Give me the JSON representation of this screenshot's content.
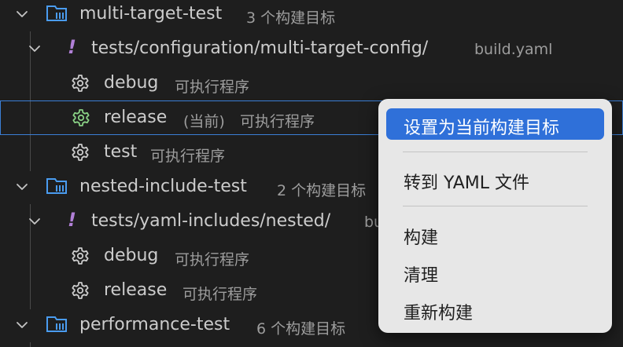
{
  "tree": {
    "project1": {
      "name": "multi-target-test",
      "desc": "3 个构建目标"
    },
    "config1": {
      "path": "tests/configuration/multi-target-config/",
      "file": "build.yaml"
    },
    "target_debug1": {
      "name": "debug",
      "desc": "可执行程序"
    },
    "target_release1": {
      "name": "release",
      "current": "(当前)",
      "desc": "可执行程序"
    },
    "target_test1": {
      "name": "test",
      "desc": "可执行程序"
    },
    "project2": {
      "name": "nested-include-test",
      "desc": "2 个构建目标"
    },
    "config2": {
      "path": "tests/yaml-includes/nested/",
      "file": "bu"
    },
    "target_debug2": {
      "name": "debug",
      "desc": "可执行程序"
    },
    "target_release2": {
      "name": "release",
      "desc": "可执行程序"
    },
    "project3": {
      "name": "performance-test",
      "desc": "6 个构建目标"
    },
    "warning_glyph": "!"
  },
  "context_menu": {
    "set_current": "设置为当前构建目标",
    "goto_yaml": "转到 YAML 文件",
    "build": "构建",
    "clean": "清理",
    "rebuild": "重新构建"
  },
  "colors": {
    "background": "#1e1e1e",
    "project_icon": "#4a9cf0",
    "warning": "#b180d7",
    "current_gear": "#89d185",
    "selection_border": "#3b7fd6",
    "menu_highlight": "#2f70d9",
    "menu_background": "#e7e7e7"
  },
  "icons": {
    "project": "project-list-icon",
    "config": "warning-exclamation-icon",
    "target": "gear-icon",
    "expand": "chevron-down-icon"
  }
}
